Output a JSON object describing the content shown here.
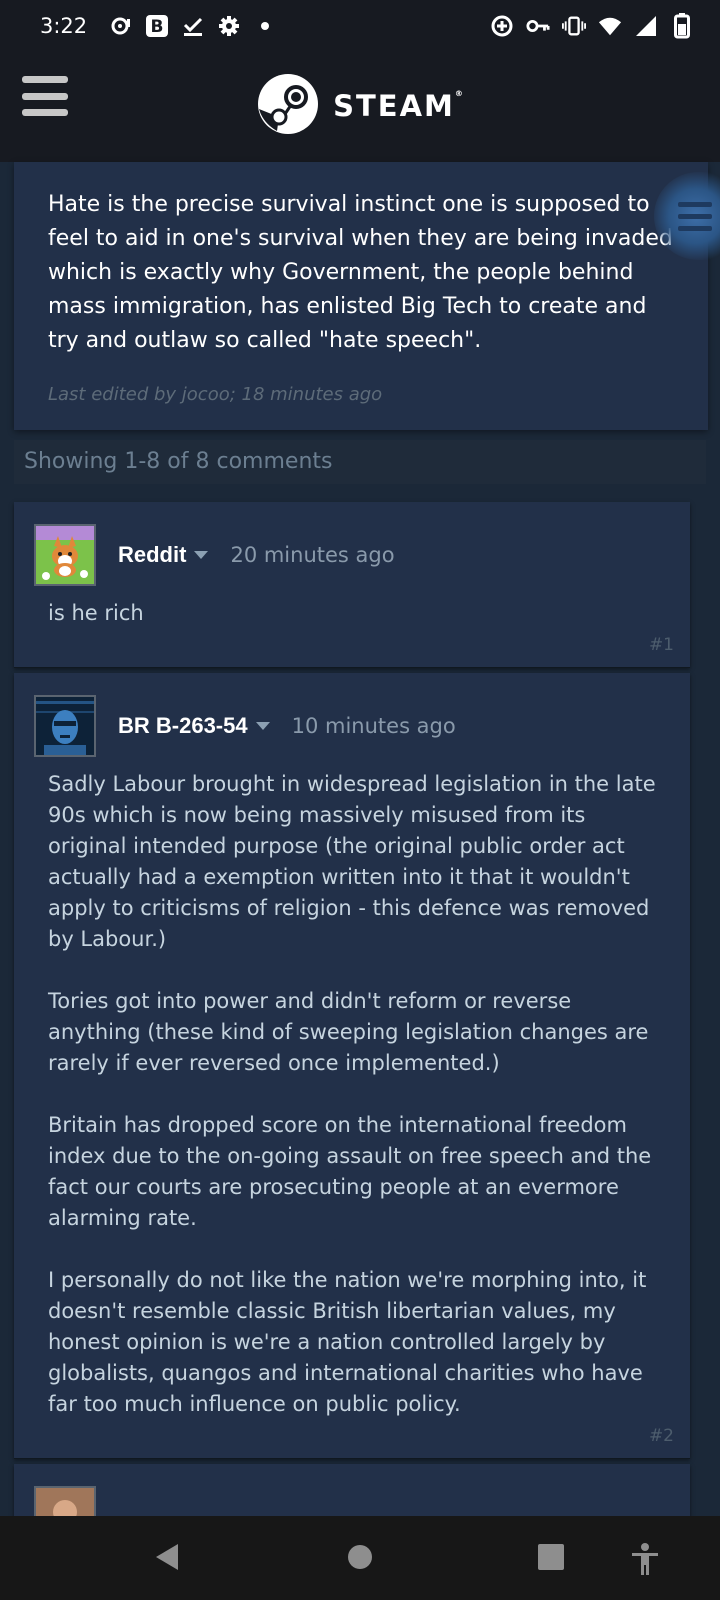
{
  "status_bar": {
    "time": "3:22",
    "left_icons": [
      "sync-icon",
      "b-app-icon",
      "check-download-icon",
      "settings-icon",
      "dot-icon"
    ],
    "right_icons": [
      "data-saver-icon",
      "key-icon",
      "vibrate-icon",
      "wifi-icon",
      "signal-icon",
      "battery-icon"
    ]
  },
  "header": {
    "brand": "STEAM",
    "menu_icon": "hamburger-menu-icon",
    "logo_icon": "steam-logo-icon"
  },
  "original_post": {
    "text": "Hate is the precise survival instinct one is supposed to feel to aid in one's survival when they are being invaded which is exactly why Government, the people behind mass immigration, has enlisted Big Tech to create and try and outlaw so called \"hate speech\".",
    "edited_prefix": "Last edited by ",
    "edited_by": "jocoo",
    "edited_suffix": "; 18 minutes ago"
  },
  "comments_summary": "Showing 1-8 of 8 comments",
  "comments": [
    {
      "author": "Reddit",
      "time": "20 minutes ago",
      "body": "is he rich",
      "number": "#1",
      "avatar": "corgi-avatar"
    },
    {
      "author": "BR B-263-54",
      "time": "10 minutes ago",
      "body": "Sadly Labour brought in widespread legislation in the late 90s which is now being massively misused from its original intended purpose (the original public order act actually had a exemption written into it that it wouldn't apply to criticisms of religion - this defence was removed by Labour.)\n\nTories got into power and didn't reform or reverse anything (these kind of sweeping legislation changes are rarely if ever reversed once implemented.)\n\nBritain has dropped score on the international freedom index due to the on-going assault on free speech and the fact our courts are prosecuting people at an evermore alarming rate.\n\nI personally do not like the nation we're morphing into, it doesn't resemble classic British libertarian values, my honest opinion is we're a nation controlled largely by globalists, quangos and international charities who have far too much influence on public policy.",
      "number": "#2",
      "avatar": "blue-face-avatar"
    }
  ],
  "nav_bar": {
    "buttons": [
      "back-icon",
      "home-icon",
      "recents-icon",
      "accessibility-icon"
    ]
  },
  "colors": {
    "background": "#1b2838",
    "header": "#171a21",
    "card": "#223049",
    "text": "#c6d4df"
  }
}
